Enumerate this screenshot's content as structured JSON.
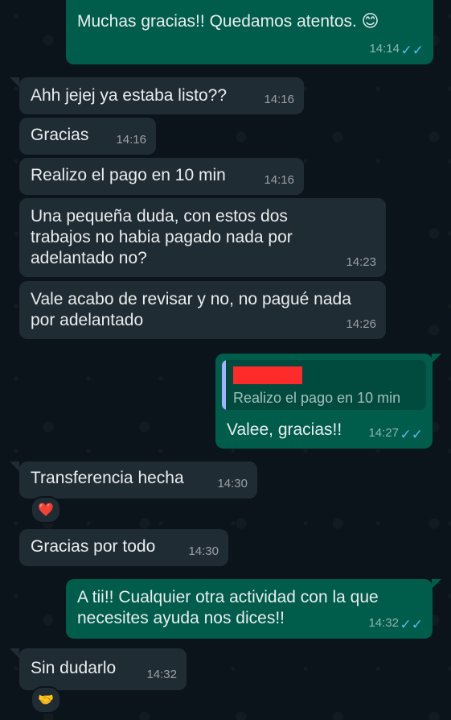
{
  "messages": [
    {
      "dir": "out",
      "text": "Muchas gracias!! Quedamos atentos. 😊",
      "time": "14:14",
      "ticks": "✓✓"
    },
    {
      "dir": "in",
      "text": "Ahh jejej ya estaba listo??",
      "time": "14:16"
    },
    {
      "dir": "in",
      "text": "Gracias",
      "time": "14:16"
    },
    {
      "dir": "in",
      "text": "Realizo el pago en 10 min",
      "time": "14:16"
    },
    {
      "dir": "in",
      "text": "Una pequeña duda, con estos dos\ntrabajos no habia pagado nada por\nadelantado no?",
      "time": "14:23"
    },
    {
      "dir": "in",
      "text": "Vale acabo de revisar y no, no pagué nada\npor adelantado",
      "time": "14:26"
    },
    {
      "dir": "out",
      "quote": "Realizo el pago en 10 min",
      "text": "Valee, gracias!!",
      "time": "14:27",
      "ticks": "✓✓"
    },
    {
      "dir": "in",
      "text": "Transferencia hecha",
      "time": "14:30",
      "reaction": "❤️"
    },
    {
      "dir": "in",
      "text": "Gracias por todo",
      "time": "14:30"
    },
    {
      "dir": "out",
      "text": "A tii!! Cualquier otra actividad con la que\nnecesites ayuda nos dices!!",
      "time": "14:32",
      "ticks": "✓✓"
    },
    {
      "dir": "in",
      "text": "Sin dudarlo",
      "time": "14:32",
      "reaction": "🤝"
    }
  ]
}
